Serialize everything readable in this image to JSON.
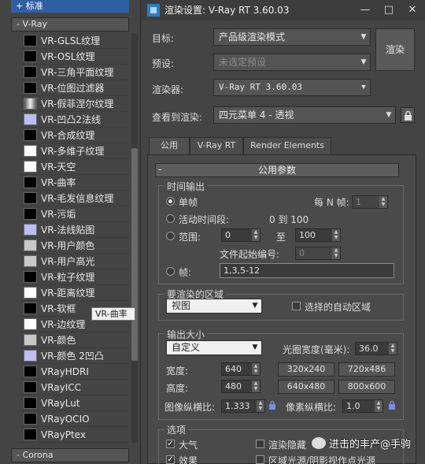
{
  "browser": {
    "standard_label": "+ 标准",
    "vray_rollout": "- V-Ray",
    "corona_rollout": "- Corona",
    "maps": [
      {
        "name": "VR-GLSL纹理",
        "swatch": "#000000"
      },
      {
        "name": "VR-OSL纹理",
        "swatch": "#000000"
      },
      {
        "name": "VR-三角平面纹理",
        "swatch": "#000000"
      },
      {
        "name": "VR-位图过滤器",
        "swatch": "#000000"
      },
      {
        "name": "VR-假菲涅尔纹理",
        "swatch": "gradient"
      },
      {
        "name": "VR-凹凸2法线",
        "swatch": "#bdbdf0"
      },
      {
        "name": "VR-合成纹理",
        "swatch": "#000000"
      },
      {
        "name": "VR-多维子纹理",
        "swatch": "#ffffff"
      },
      {
        "name": "VR-天空",
        "swatch": "#ffffff"
      },
      {
        "name": "VR-曲率",
        "swatch": "#000000"
      },
      {
        "name": "VR-毛发信息纹理",
        "swatch": "#000000"
      },
      {
        "name": "VR-污垢",
        "swatch": "#000000"
      },
      {
        "name": "VR-法线贴图",
        "swatch": "#bdbdf0"
      },
      {
        "name": "VR-用户颜色",
        "swatch": "#c8c8c8"
      },
      {
        "name": "VR-用户高光",
        "swatch": "#c8c8c8"
      },
      {
        "name": "VR-粒子纹理",
        "swatch": "#000000"
      },
      {
        "name": "VR-距离纹理",
        "swatch": "#ffffff"
      },
      {
        "name": "VR-软框",
        "swatch": "#000000"
      },
      {
        "name": "VR-边纹理",
        "swatch": "#ffffff"
      },
      {
        "name": "VR-颜色",
        "swatch": "#c8c8c8"
      },
      {
        "name": "VR-颜色 2凹凸",
        "swatch": "#bdbdf0"
      },
      {
        "name": "VRayHDRI",
        "swatch": "#000000"
      },
      {
        "name": "VRayICC",
        "swatch": "#000000"
      },
      {
        "name": "VRayLut",
        "swatch": "#000000"
      },
      {
        "name": "VRayOCIO",
        "swatch": "#000000"
      },
      {
        "name": "VRayPtex",
        "swatch": "#000000"
      }
    ],
    "tooltip": "VR-曲率"
  },
  "dialog": {
    "title": "渲染设置: V-Ray RT 3.60.03",
    "target_label": "目标:",
    "target_value": "产品级渲染模式",
    "preset_label": "预设:",
    "preset_value": "未选定预设",
    "renderer_label": "渲染器:",
    "renderer_value": "V-Ray RT 3.60.03",
    "view_label": "查看到渲染:",
    "view_value": "四元菜单 4 - 透视",
    "render_button": "渲染",
    "tabs": [
      "公用",
      "V-Ray RT",
      "Render Elements"
    ],
    "rollout_title": "公用参数",
    "time_output": {
      "title": "时间输出",
      "single": "单帧",
      "every_n_label": "每 N 帧:",
      "every_n_value": "1",
      "active_segment": "活动时间段:",
      "active_range": "0 到 100",
      "range": "范围:",
      "range_start": "0",
      "range_to": "至",
      "range_end": "100",
      "file_number_label": "文件起始编号:",
      "file_number_value": "0",
      "frames": "帧:",
      "frames_value": "1,3,5-12"
    },
    "area": {
      "title": "要渲染的区域",
      "value": "视图",
      "auto_region": "选择的自动区域"
    },
    "output_size": {
      "title": "输出大小",
      "preset": "自定义",
      "aperture_label": "光圈宽度(毫米):",
      "aperture_value": "36.0",
      "width_label": "宽度:",
      "width_value": "640",
      "height_label": "高度:",
      "height_value": "480",
      "presets": [
        "320x240",
        "720x486",
        "640x480",
        "800x600"
      ],
      "image_aspect_label": "图像纵横比:",
      "image_aspect_value": "1.333",
      "pixel_aspect_label": "像素纵横比:",
      "pixel_aspect_value": "1.0"
    },
    "options": {
      "title": "选项",
      "atmospherics": "大气",
      "render_hidden": "渲染隐藏",
      "effects": "效果",
      "area_lights": "区域光源/阴影视作点光源"
    }
  },
  "watermark": "进击的丰产@手驹"
}
